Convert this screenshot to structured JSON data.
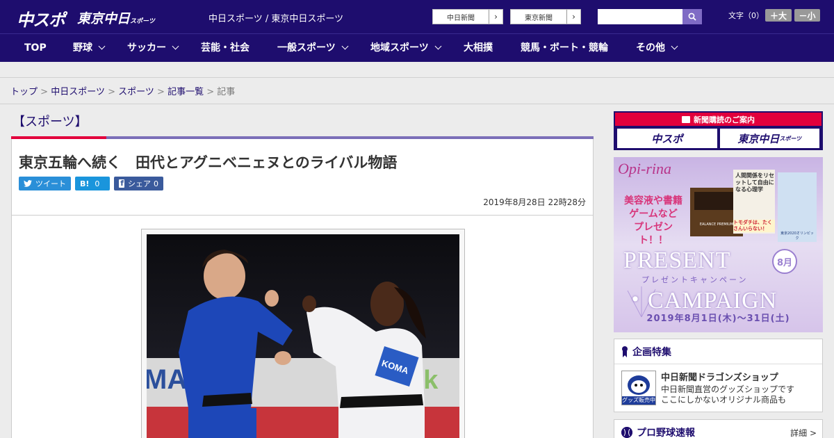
{
  "header": {
    "logo_chuspo": "中スポ",
    "logo_tokyo": "東京中日",
    "logo_tokyo_small": "スポーツ",
    "tagline": "中日スポーツ / 東京中日スポーツ",
    "newspaper_links": [
      {
        "label": "中日新聞",
        "arrow": "›"
      },
      {
        "label": "東京新聞",
        "arrow": "›"
      }
    ],
    "search": {
      "placeholder": ""
    },
    "font_size": {
      "label": "文字（0）",
      "larger": "＋大",
      "smaller": "－小"
    }
  },
  "nav": {
    "items": [
      {
        "label": "TOP"
      },
      {
        "label": "野球"
      },
      {
        "label": "サッカー"
      },
      {
        "label": "芸能・社会"
      },
      {
        "label": "一般スポーツ"
      },
      {
        "label": "地域スポーツ"
      },
      {
        "label": "大相撲"
      },
      {
        "label": "競馬・ボート・競輪"
      },
      {
        "label": "その他"
      }
    ]
  },
  "breadcrumb": {
    "items": [
      "トップ",
      "中日スポーツ",
      "スポーツ",
      "記事一覧"
    ],
    "separator": ">",
    "current": "記事"
  },
  "category": {
    "title": "【スポーツ】"
  },
  "article": {
    "headline": "東京五輪へ続く　田代とアグニベニェヌとのライバル物語",
    "share": {
      "tweet": "ツイート",
      "hatena": "B!",
      "hatena_count": "0",
      "facebook": "シェア",
      "facebook_count": "0"
    },
    "date": "2019年8月28日 22時28分",
    "photo_text": {
      "mat_text": "MAT",
      "gi_text": "KOMA",
      "bg_text": "ok"
    }
  },
  "sidebar": {
    "subscription": {
      "head": "新聞購読のご案内",
      "logo_chuspo": "中スポ",
      "logo_tokyo": "東京中日",
      "logo_tokyo_small": "スポーツ"
    },
    "campaign_banner": {
      "brand": "Opi-rina",
      "line1": "美容液や書籍",
      "line2": "ゲームなど",
      "line3": "プレゼント！！",
      "present": "PRESENT",
      "month": "8月",
      "ruby": "プレゼントキャンペーン",
      "campaign": "・CAMPAIGN",
      "period": "2019年8月1日(木)～31日(土)",
      "book_title": "人間関係をリセットして自由になる心理学",
      "book_sub": "トモダチは、たくさんいらない！",
      "game_label": "東京2020オリンピック",
      "box_label": "EALANCE PREMIUM"
    },
    "feature": {
      "title": "企画特集",
      "item_title": "中日新聞ドラゴンズショップ",
      "item_desc_1": "中日新聞直営のグッズショップです",
      "item_desc_2": "ここにしかないオリジナル商品も",
      "thumb_label": "グッズ販売中"
    },
    "baseball": {
      "title": "プロ野球速報",
      "details": "詳細 >"
    }
  },
  "colors": {
    "brand_navy": "#1e0d6e",
    "accent_red": "#e2003c",
    "accent_purple": "#7b6fb8"
  }
}
